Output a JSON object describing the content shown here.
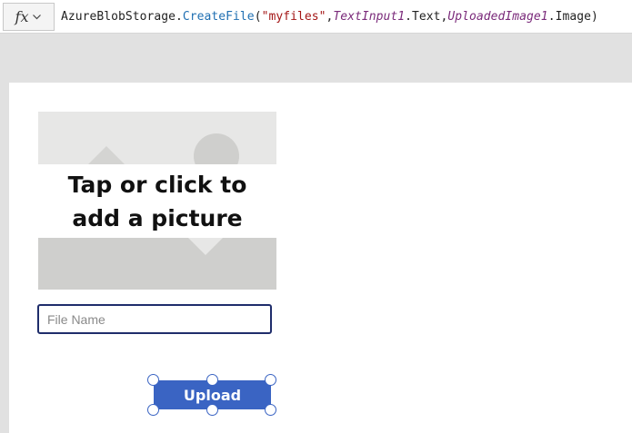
{
  "formula_bar": {
    "fx_label": "fx",
    "formula_parts": [
      {
        "text": "AzureBlobStorage.",
        "kind": "plain"
      },
      {
        "text": "CreateFile",
        "kind": "function"
      },
      {
        "text": "(",
        "kind": "plain"
      },
      {
        "text": "\"myfiles\"",
        "kind": "string"
      },
      {
        "text": ",",
        "kind": "plain"
      },
      {
        "text": "TextInput1",
        "kind": "control"
      },
      {
        "text": ".Text,",
        "kind": "plain"
      },
      {
        "text": "UploadedImage1",
        "kind": "control"
      },
      {
        "text": ".Image)",
        "kind": "plain"
      }
    ]
  },
  "add_picture": {
    "label": "Tap or click to add a picture"
  },
  "file_name_input": {
    "placeholder": "File Name",
    "value": ""
  },
  "upload_button": {
    "label": "Upload",
    "selected": true
  },
  "colors": {
    "accent": "#3a64c3",
    "input_border": "#1f2d6b",
    "function_token": "#1f6fb2",
    "string_token": "#a31515",
    "control_token": "#7a2a7a"
  },
  "icons": {
    "fx_button": "fx-icon",
    "dropdown": "chevron-down-icon",
    "picture_placeholder": "image-placeholder-icon"
  }
}
